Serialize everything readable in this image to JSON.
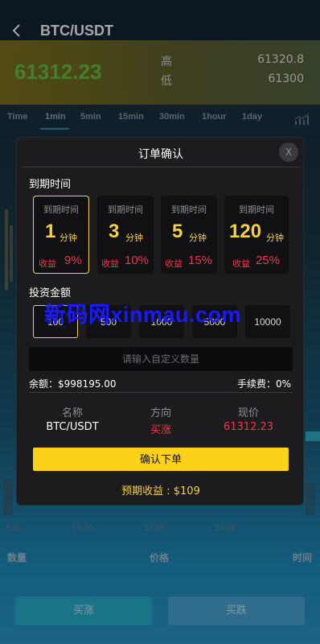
{
  "header": {
    "pair": "BTC/USDT"
  },
  "ticker": {
    "last_price": "61312.23",
    "high_label": "高",
    "high_value": "61320.8",
    "low_label": "低",
    "low_value": "61300"
  },
  "timeframes": [
    "Time",
    "1min",
    "5min",
    "15min",
    "30min",
    "1hour",
    "1day"
  ],
  "chart": {
    "time_ticks": [
      "3:15",
      "13:30",
      "13:45",
      "14:00"
    ]
  },
  "orderbook": {
    "col_amount": "数量",
    "col_price": "价格",
    "col_time": "时间"
  },
  "actions": {
    "buy_label": "买涨",
    "sell_label": "买跌"
  },
  "modal": {
    "title": "订单确认",
    "close_label": "X",
    "expiry_section": "到期时间",
    "expiry_options": [
      {
        "label": "到期时间",
        "num": "1",
        "unit": "分钟",
        "rate_label": "收益",
        "rate": "9%"
      },
      {
        "label": "到期时间",
        "num": "3",
        "unit": "分钟",
        "rate_label": "收益",
        "rate": "10%"
      },
      {
        "label": "到期时间",
        "num": "5",
        "unit": "分钟",
        "rate_label": "收益",
        "rate": "15%"
      },
      {
        "label": "到期时间",
        "num": "120",
        "unit": "分钟",
        "rate_label": "收益",
        "rate": "25%"
      }
    ],
    "amount_section": "投资金额",
    "amounts": [
      "100",
      "500",
      "1000",
      "5000",
      "10000"
    ],
    "watermark": "新码网xinmau.com",
    "custom_placeholder": "请输入自定义数量",
    "balance_label": "余额：",
    "balance_value": "$998195.00",
    "fee_label": "手续费：",
    "fee_value": "0%",
    "info_headers": [
      "名称",
      "方向",
      "现价"
    ],
    "info_values": [
      "BTC/USDT",
      "买涨",
      "61312.23"
    ],
    "confirm_label": "确认下单",
    "expected_label": "预期收益 : $109"
  },
  "colors": {
    "accent_yellow": "#f5d142",
    "rise_red": "#e83a4a",
    "price_green": "#6cc24a"
  }
}
